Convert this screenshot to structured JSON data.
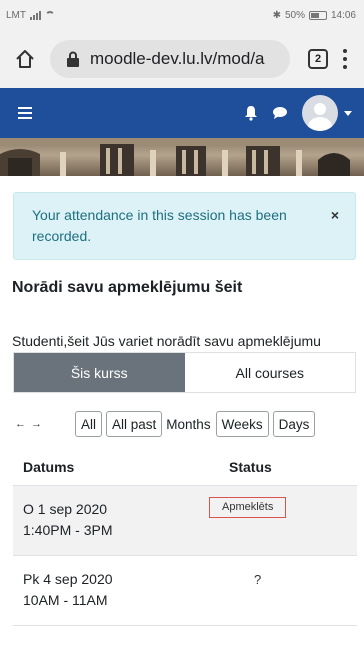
{
  "status_bar": {
    "left": "LMT",
    "right": "50% ",
    "time": "14:06"
  },
  "browser": {
    "url": "moodle-dev.lu.lv/mod/a",
    "tab_count": "2"
  },
  "alert": {
    "message": "Your attendance in this session has been recorded.",
    "close": "×"
  },
  "page": {
    "heading": "Norādi savu apmeklējumu šeit",
    "description": "Studenti,šeit Jūs variet norādīt savu apmeklējumu"
  },
  "tabs": [
    {
      "label": "Šis kurss",
      "active": true
    },
    {
      "label": "All courses",
      "active": false
    }
  ],
  "filters": {
    "arrows": "← →",
    "all": "All",
    "all_past": "All past",
    "months": "Months",
    "weeks": "Weeks",
    "days": "Days"
  },
  "table": {
    "headers": {
      "date": "Datums",
      "status": "Status"
    },
    "rows": [
      {
        "date": "O 1 sep 2020",
        "time": "1:40PM - 3PM",
        "status": "Apmeklēts"
      },
      {
        "date": "Pk 4 sep 2020",
        "time": "10AM - 11AM",
        "status": "?"
      }
    ]
  },
  "colors": {
    "navbar": "#1f4e9b",
    "alert_bg": "#dcf2f6",
    "alert_text": "#1e6f80",
    "active_tab": "#6a737b",
    "status_border": "#d9534f"
  }
}
